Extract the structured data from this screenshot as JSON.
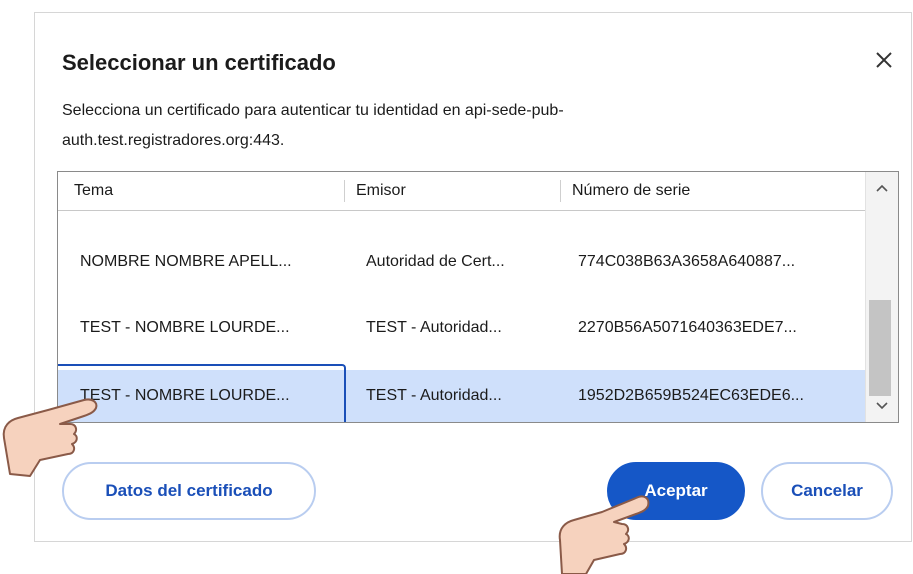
{
  "dialog": {
    "title": "Seleccionar un certificado",
    "description": "Selecciona un certificado para autenticar tu identidad en api-sede-pub-auth.test.registradores.org:443."
  },
  "table": {
    "columns": [
      "Tema",
      "Emisor",
      "Número de serie"
    ],
    "rows": [
      {
        "tema": "NOMBRE NOMBRE APELL...",
        "emisor": "Autoridad de Cert...",
        "serie": "774C038B63A3658A640887..."
      },
      {
        "tema": "TEST - NOMBRE LOURDE...",
        "emisor": "TEST - Autoridad...",
        "serie": "2270B56A5071640363EDE7..."
      },
      {
        "tema": "TEST - NOMBRE LOURDE...",
        "emisor": "TEST - Autoridad...",
        "serie": "1952D2B659B524EC63EDE6..."
      }
    ],
    "selected_row": 2
  },
  "buttons": {
    "details": "Datos del certificado",
    "accept": "Aceptar",
    "cancel": "Cancelar"
  },
  "colors": {
    "accent": "#1557c7",
    "selection": "#cfe0fb"
  },
  "icons": {
    "close": "close-icon",
    "scroll_up": "chevron-up-icon",
    "scroll_down": "chevron-down-icon",
    "pointer": "hand-pointer-icon"
  }
}
